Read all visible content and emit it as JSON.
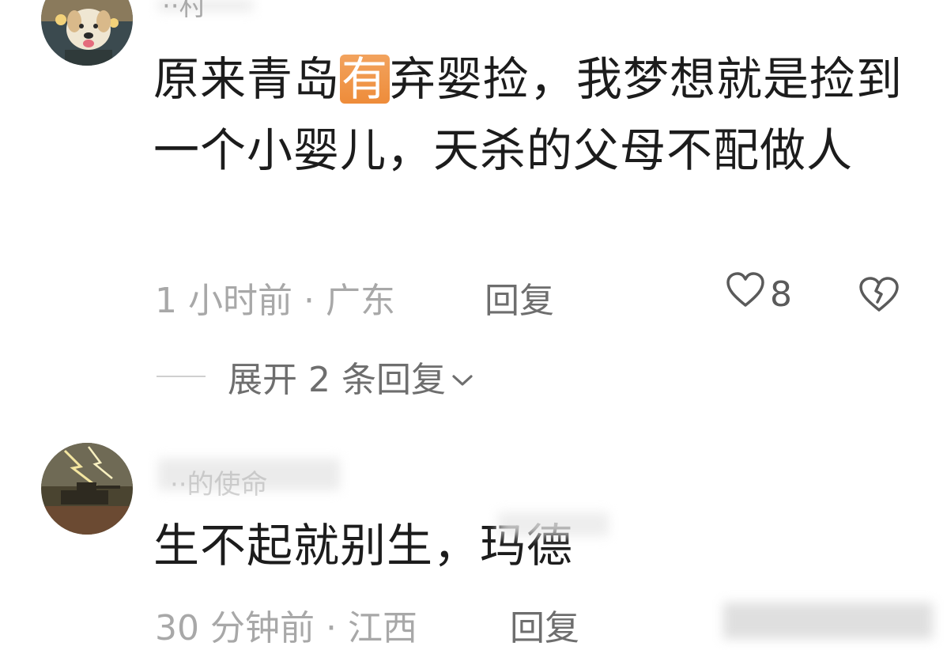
{
  "comments": [
    {
      "username": "··村",
      "text_before": "原来青岛",
      "text_highlight": "有",
      "text_after": "弃婴捡，我梦想就是捡到一个小婴儿，天杀的父母不配做人",
      "time": "1 小时前",
      "location": "广东",
      "reply_label": "回复",
      "like_count": "8",
      "expand_label": "展开 2 条回复"
    },
    {
      "username": "··的使命",
      "text": "生不起就别生，玛德",
      "time": "30 分钟前",
      "location": "江西",
      "reply_label": "回复"
    }
  ],
  "separator": "·",
  "colors": {
    "highlight": "#f09a4a",
    "meta_gray": "#a8a8a8",
    "text": "#1c1c1c"
  },
  "icons": {
    "like": "heart-icon",
    "dislike": "broken-heart-icon",
    "expand": "chevron-down-icon"
  }
}
